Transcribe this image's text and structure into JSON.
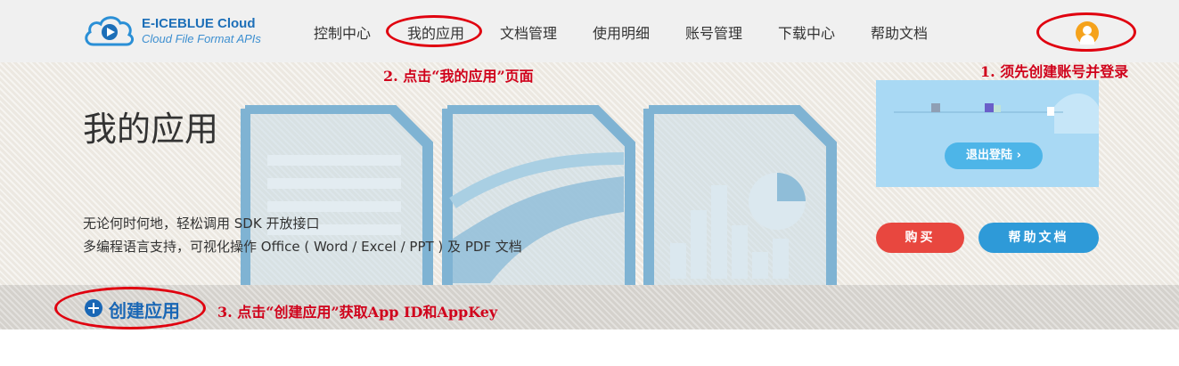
{
  "brand": {
    "title": "E-ICEBLUE Cloud",
    "subtitle": "Cloud File Format APIs"
  },
  "nav": {
    "items": [
      {
        "label": "控制中心"
      },
      {
        "label": "我的应用"
      },
      {
        "label": "文档管理"
      },
      {
        "label": "使用明细"
      },
      {
        "label": "账号管理"
      },
      {
        "label": "下载中心"
      },
      {
        "label": "帮助文档"
      }
    ]
  },
  "hero": {
    "title": "我的应用",
    "desc_line1": "无论何时何地，轻松调用 SDK 开放接口",
    "desc_line2": "多编程语言支持，可视化操作 Office ( Word / Excel / PPT ) 及 PDF 文档"
  },
  "user_panel": {
    "logout_label": "退出登陆 ›",
    "buy_label": "购买",
    "help_label": "帮助文档"
  },
  "actions": {
    "create_label": "创建应用"
  },
  "annotations": {
    "step1": "1. 须先创建账号并登录",
    "step2": "2.  点击“我的应用”页面",
    "step3": "3. 点击“创建应用”获取App ID和AppKey"
  },
  "icons": {
    "logo": "cloud-play-logo-icon",
    "user": "user-avatar-icon",
    "plus": "plus-circle-icon"
  },
  "colors": {
    "brand_blue": "#1d6fb8",
    "annotation_red": "#d0021b",
    "buy_red": "#e8473f",
    "help_blue": "#2e9ad8",
    "avatar_orange": "#f5a21b"
  }
}
